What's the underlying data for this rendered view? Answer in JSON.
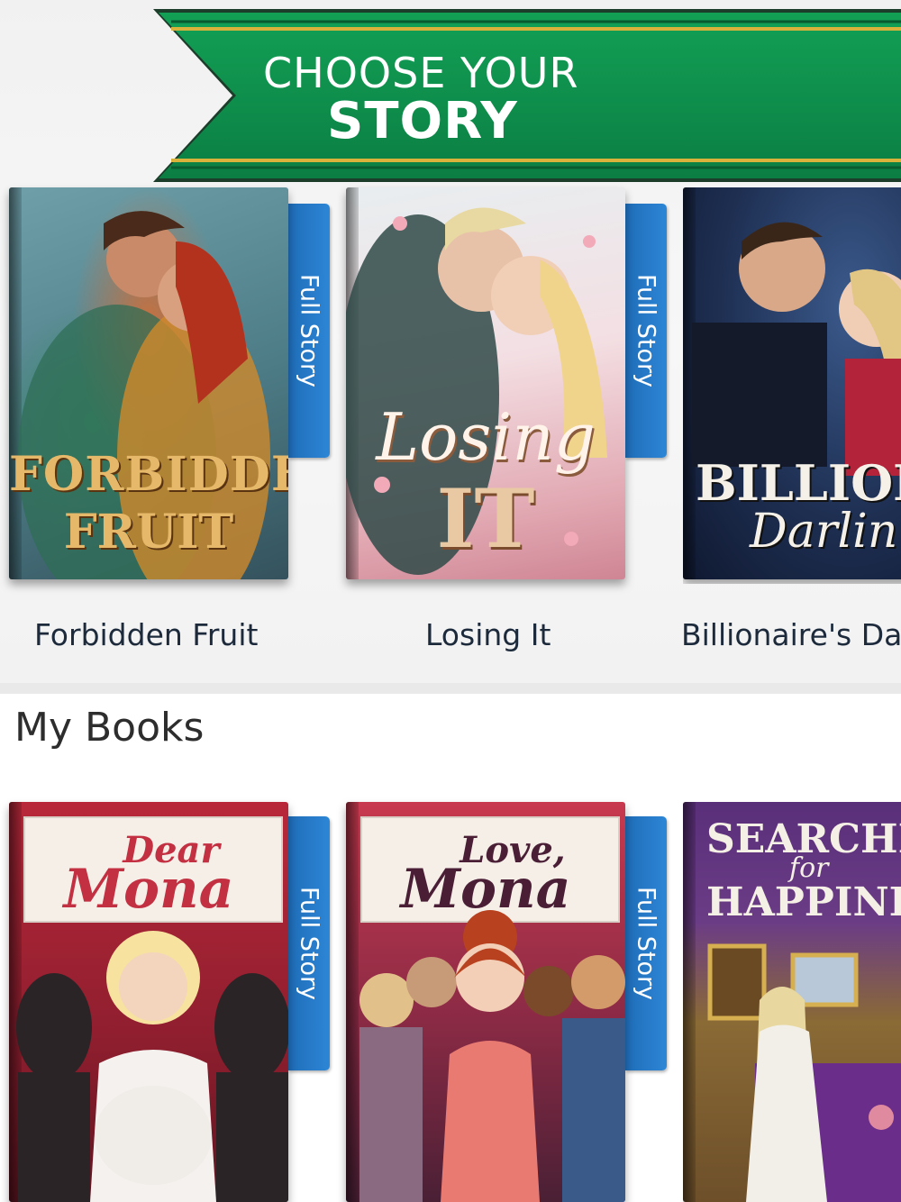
{
  "banner": {
    "line1": "CHOOSE YOUR",
    "line2": "STORY"
  },
  "featured": [
    {
      "title": "Forbidden Fruit",
      "cover_line1": "FORBIDDEN",
      "cover_line2": "FRUIT",
      "tab": "Full Story"
    },
    {
      "title": "Losing It",
      "cover_line1": "Losing",
      "cover_line2": "IT",
      "tab": "Full Story"
    },
    {
      "title": "Billionaire's Da",
      "cover_line1": "BILLIONAIR",
      "cover_line2": "Darlin"
    }
  ],
  "my_books": {
    "heading": "My Books",
    "items": [
      {
        "cover_line1": "Dear",
        "cover_line2": "Mona",
        "tab": "Full Story"
      },
      {
        "cover_line1": "Love,",
        "cover_line2": "Mona",
        "tab": "Full Story"
      },
      {
        "cover_line1": "SEARCHIN",
        "cover_line2": "for",
        "cover_line3": "HAPPINES"
      }
    ]
  },
  "colors": {
    "banner_green": "#0f8a4b",
    "banner_gold": "#c9a227",
    "tab_blue": "#2479c6"
  }
}
